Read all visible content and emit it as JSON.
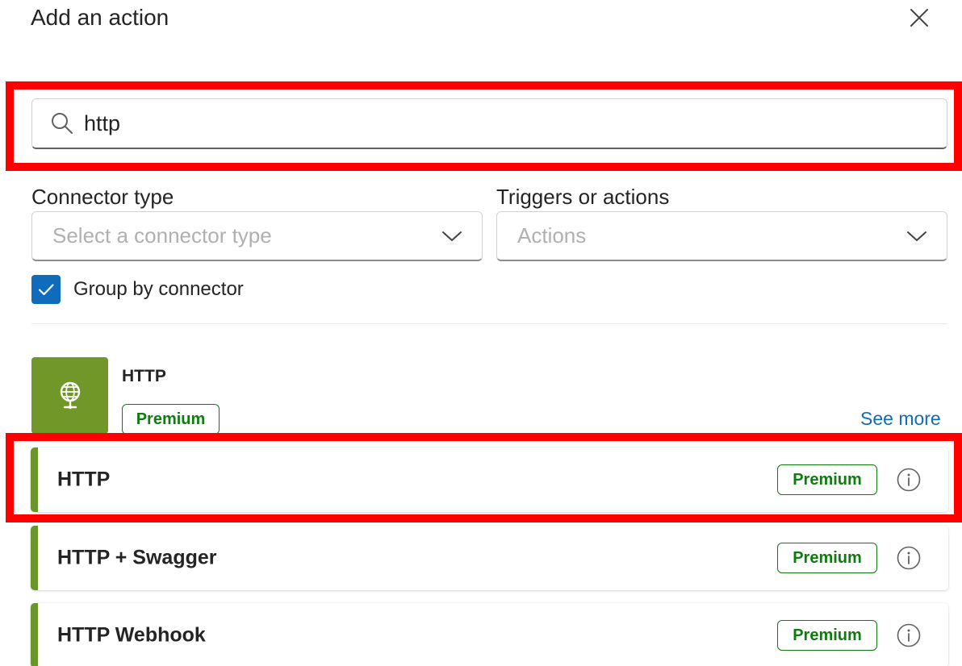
{
  "dialog": {
    "title": "Add an action"
  },
  "search": {
    "value": "http"
  },
  "filters": {
    "connector_type": {
      "label": "Connector type",
      "placeholder": "Select a connector type"
    },
    "triggers_actions": {
      "label": "Triggers or actions",
      "value": "Actions"
    }
  },
  "group_by": {
    "label": "Group by connector",
    "checked": true
  },
  "connector": {
    "name": "HTTP",
    "badge": "Premium",
    "see_more": "See more",
    "icon": "globe-icon",
    "color": "#709727"
  },
  "actions": [
    {
      "label": "HTTP",
      "badge": "Premium"
    },
    {
      "label": "HTTP + Swagger",
      "badge": "Premium"
    },
    {
      "label": "HTTP Webhook",
      "badge": "Premium"
    }
  ],
  "colors": {
    "accent": "#0f6cbd",
    "premium": "#107c10",
    "connector_bar": "#6a9529",
    "highlight": "#ff0000"
  }
}
